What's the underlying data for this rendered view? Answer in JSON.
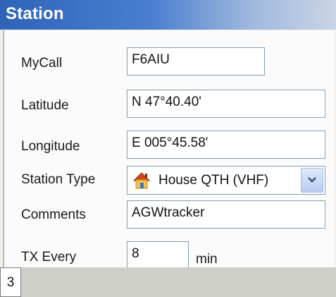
{
  "window": {
    "title": "Station"
  },
  "form": {
    "mycall": {
      "label": "MyCall",
      "value": "F6AIU"
    },
    "latitude": {
      "label": "Latitude",
      "value": "N 47°40.40'"
    },
    "longitude": {
      "label": "Longitude",
      "value": "E 005°45.58'"
    },
    "station_type": {
      "label": "Station Type",
      "value": "House QTH (VHF)",
      "icon": "house-icon"
    },
    "comments": {
      "label": "Comments",
      "value": "AGWtracker"
    },
    "tx_every": {
      "label": "TX Every",
      "value": "8",
      "unit": "min"
    }
  },
  "footer": {
    "page": "3"
  },
  "colors": {
    "title_bar": "#2f63b8",
    "field_border": "#7f9db9",
    "dropdown_button": "#b9cdf2"
  }
}
